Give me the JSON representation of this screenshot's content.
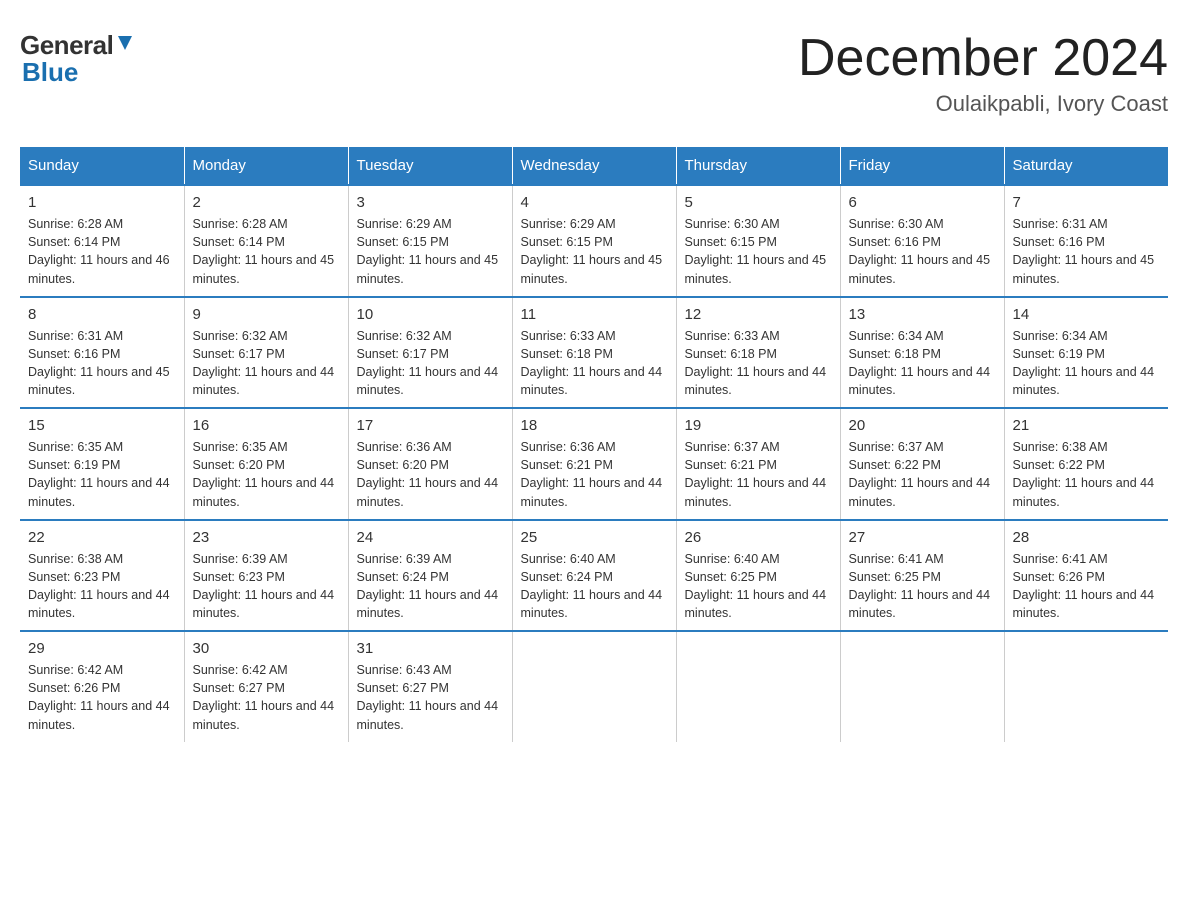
{
  "header": {
    "logo_general": "General",
    "logo_blue": "Blue",
    "title": "December 2024",
    "subtitle": "Oulaikpabli, Ivory Coast"
  },
  "days_of_week": [
    "Sunday",
    "Monday",
    "Tuesday",
    "Wednesday",
    "Thursday",
    "Friday",
    "Saturday"
  ],
  "weeks": [
    [
      {
        "day": "1",
        "sunrise": "6:28 AM",
        "sunset": "6:14 PM",
        "daylight": "11 hours and 46 minutes."
      },
      {
        "day": "2",
        "sunrise": "6:28 AM",
        "sunset": "6:14 PM",
        "daylight": "11 hours and 45 minutes."
      },
      {
        "day": "3",
        "sunrise": "6:29 AM",
        "sunset": "6:15 PM",
        "daylight": "11 hours and 45 minutes."
      },
      {
        "day": "4",
        "sunrise": "6:29 AM",
        "sunset": "6:15 PM",
        "daylight": "11 hours and 45 minutes."
      },
      {
        "day": "5",
        "sunrise": "6:30 AM",
        "sunset": "6:15 PM",
        "daylight": "11 hours and 45 minutes."
      },
      {
        "day": "6",
        "sunrise": "6:30 AM",
        "sunset": "6:16 PM",
        "daylight": "11 hours and 45 minutes."
      },
      {
        "day": "7",
        "sunrise": "6:31 AM",
        "sunset": "6:16 PM",
        "daylight": "11 hours and 45 minutes."
      }
    ],
    [
      {
        "day": "8",
        "sunrise": "6:31 AM",
        "sunset": "6:16 PM",
        "daylight": "11 hours and 45 minutes."
      },
      {
        "day": "9",
        "sunrise": "6:32 AM",
        "sunset": "6:17 PM",
        "daylight": "11 hours and 44 minutes."
      },
      {
        "day": "10",
        "sunrise": "6:32 AM",
        "sunset": "6:17 PM",
        "daylight": "11 hours and 44 minutes."
      },
      {
        "day": "11",
        "sunrise": "6:33 AM",
        "sunset": "6:18 PM",
        "daylight": "11 hours and 44 minutes."
      },
      {
        "day": "12",
        "sunrise": "6:33 AM",
        "sunset": "6:18 PM",
        "daylight": "11 hours and 44 minutes."
      },
      {
        "day": "13",
        "sunrise": "6:34 AM",
        "sunset": "6:18 PM",
        "daylight": "11 hours and 44 minutes."
      },
      {
        "day": "14",
        "sunrise": "6:34 AM",
        "sunset": "6:19 PM",
        "daylight": "11 hours and 44 minutes."
      }
    ],
    [
      {
        "day": "15",
        "sunrise": "6:35 AM",
        "sunset": "6:19 PM",
        "daylight": "11 hours and 44 minutes."
      },
      {
        "day": "16",
        "sunrise": "6:35 AM",
        "sunset": "6:20 PM",
        "daylight": "11 hours and 44 minutes."
      },
      {
        "day": "17",
        "sunrise": "6:36 AM",
        "sunset": "6:20 PM",
        "daylight": "11 hours and 44 minutes."
      },
      {
        "day": "18",
        "sunrise": "6:36 AM",
        "sunset": "6:21 PM",
        "daylight": "11 hours and 44 minutes."
      },
      {
        "day": "19",
        "sunrise": "6:37 AM",
        "sunset": "6:21 PM",
        "daylight": "11 hours and 44 minutes."
      },
      {
        "day": "20",
        "sunrise": "6:37 AM",
        "sunset": "6:22 PM",
        "daylight": "11 hours and 44 minutes."
      },
      {
        "day": "21",
        "sunrise": "6:38 AM",
        "sunset": "6:22 PM",
        "daylight": "11 hours and 44 minutes."
      }
    ],
    [
      {
        "day": "22",
        "sunrise": "6:38 AM",
        "sunset": "6:23 PM",
        "daylight": "11 hours and 44 minutes."
      },
      {
        "day": "23",
        "sunrise": "6:39 AM",
        "sunset": "6:23 PM",
        "daylight": "11 hours and 44 minutes."
      },
      {
        "day": "24",
        "sunrise": "6:39 AM",
        "sunset": "6:24 PM",
        "daylight": "11 hours and 44 minutes."
      },
      {
        "day": "25",
        "sunrise": "6:40 AM",
        "sunset": "6:24 PM",
        "daylight": "11 hours and 44 minutes."
      },
      {
        "day": "26",
        "sunrise": "6:40 AM",
        "sunset": "6:25 PM",
        "daylight": "11 hours and 44 minutes."
      },
      {
        "day": "27",
        "sunrise": "6:41 AM",
        "sunset": "6:25 PM",
        "daylight": "11 hours and 44 minutes."
      },
      {
        "day": "28",
        "sunrise": "6:41 AM",
        "sunset": "6:26 PM",
        "daylight": "11 hours and 44 minutes."
      }
    ],
    [
      {
        "day": "29",
        "sunrise": "6:42 AM",
        "sunset": "6:26 PM",
        "daylight": "11 hours and 44 minutes."
      },
      {
        "day": "30",
        "sunrise": "6:42 AM",
        "sunset": "6:27 PM",
        "daylight": "11 hours and 44 minutes."
      },
      {
        "day": "31",
        "sunrise": "6:43 AM",
        "sunset": "6:27 PM",
        "daylight": "11 hours and 44 minutes."
      },
      null,
      null,
      null,
      null
    ]
  ]
}
